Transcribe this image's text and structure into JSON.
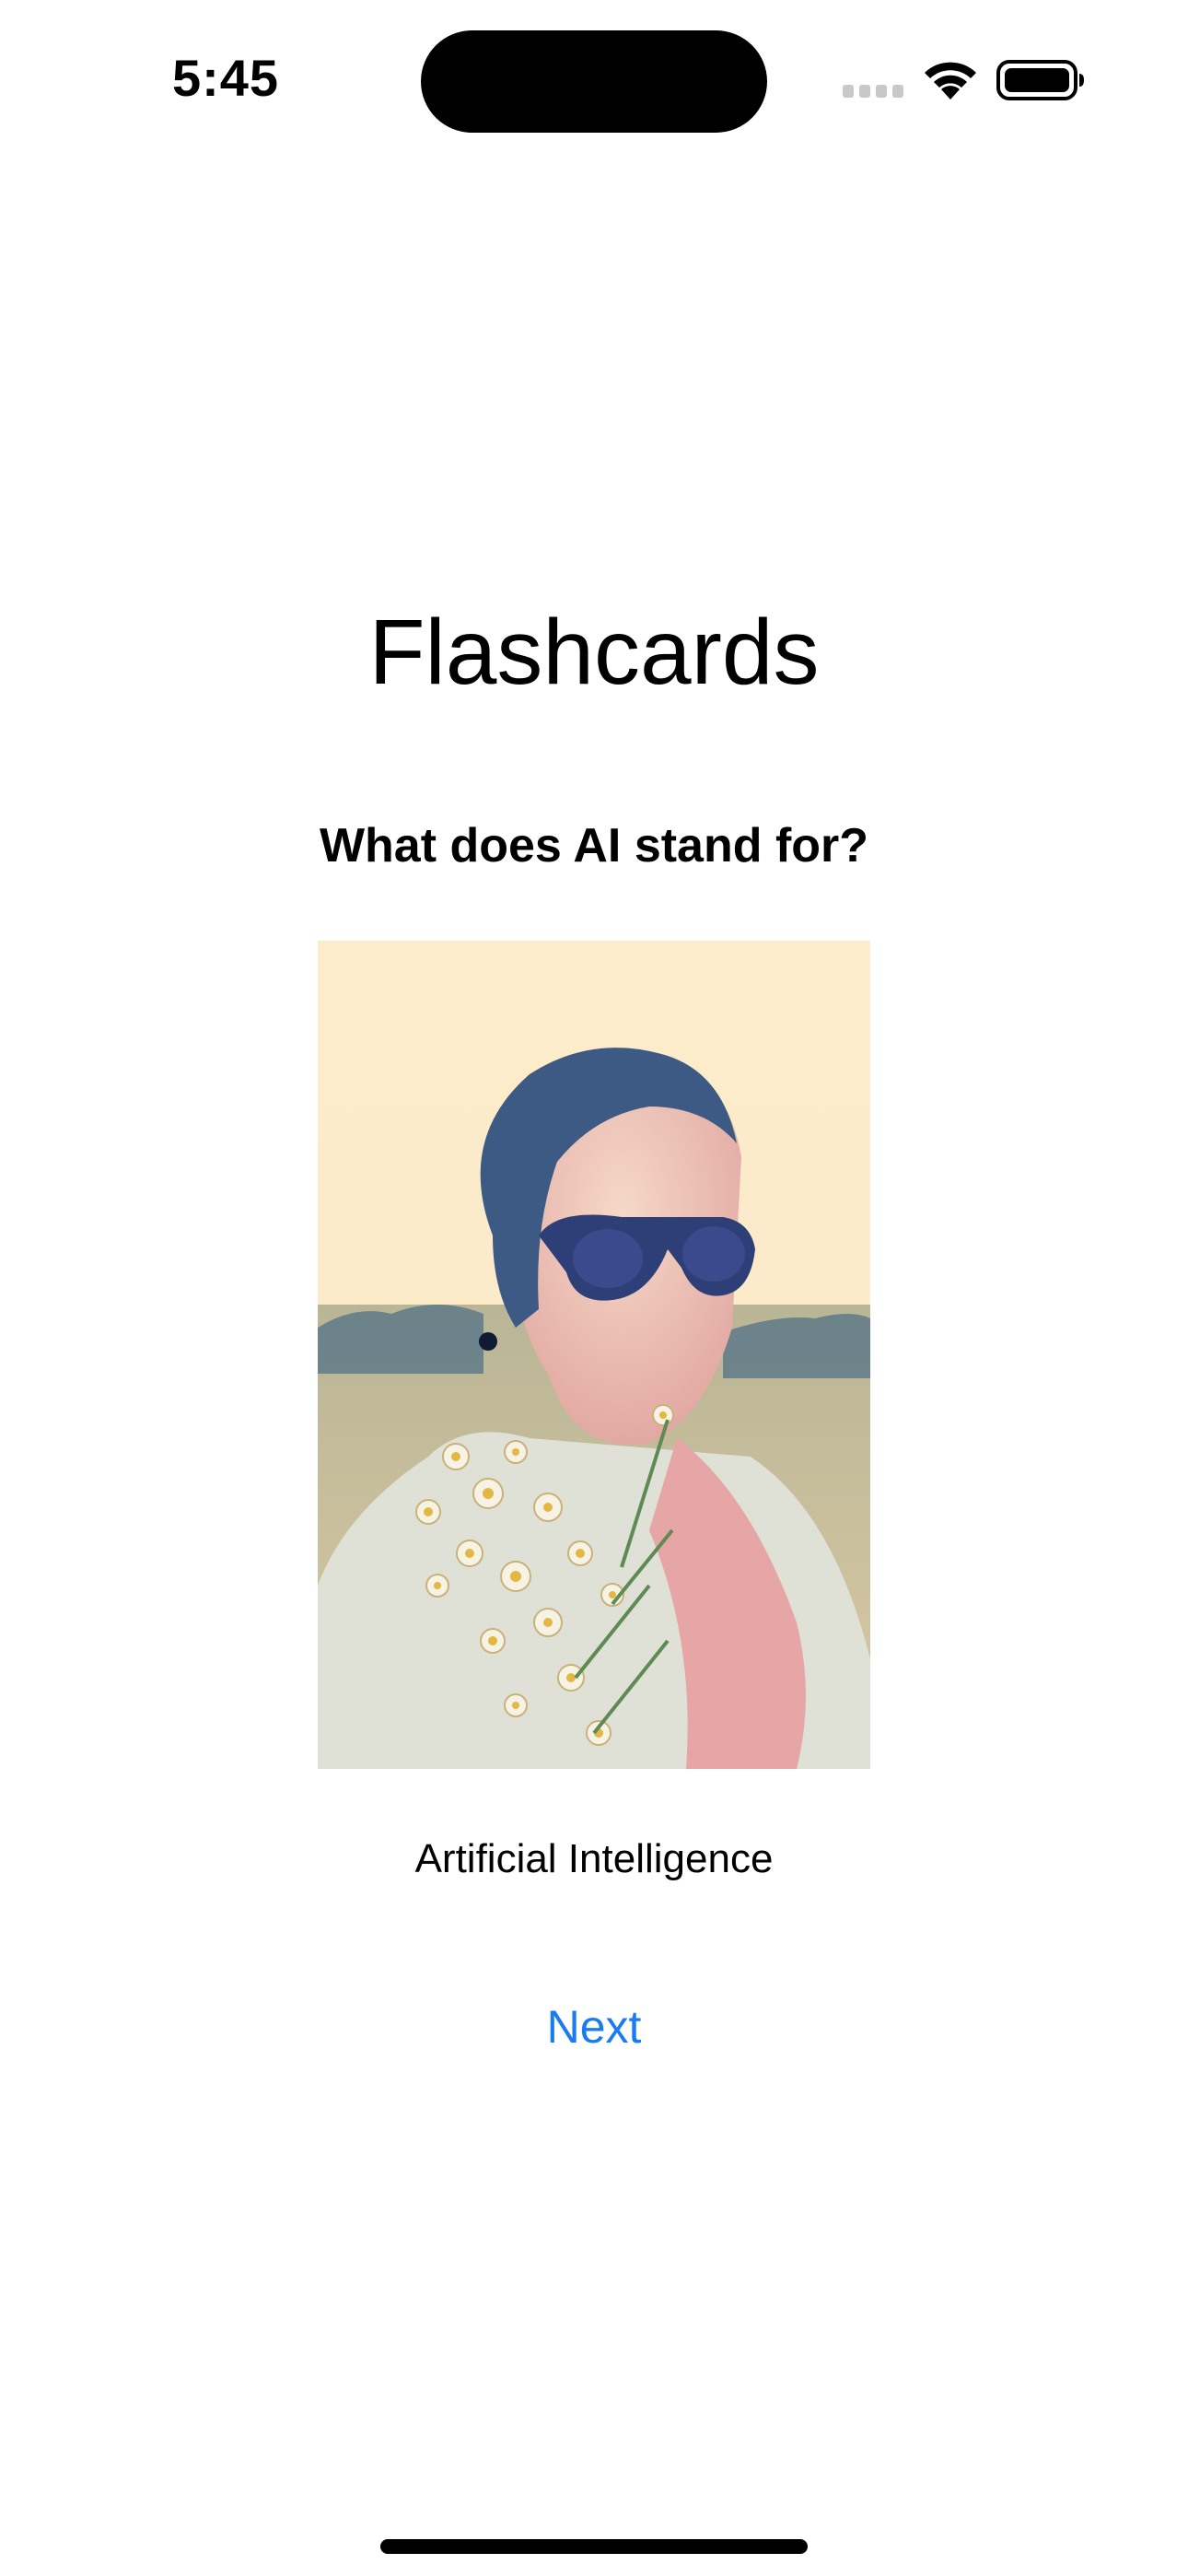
{
  "status_bar": {
    "time": "5:45",
    "icons": [
      "cellular-signal-icon",
      "wifi-icon",
      "battery-icon"
    ]
  },
  "screen": {
    "title": "Flashcards",
    "question": "What does AI stand for?",
    "image": {
      "icon": "flashcard-photo",
      "description_colors": {
        "sky": "#fdecc8",
        "field": "#cfc39a",
        "treeline": "#5f7a84"
      }
    },
    "answer": "Artificial Intelligence",
    "next_label": "Next"
  },
  "colors": {
    "accent": "#1a7cf1",
    "background": "#ffffff",
    "text": "#000000"
  }
}
